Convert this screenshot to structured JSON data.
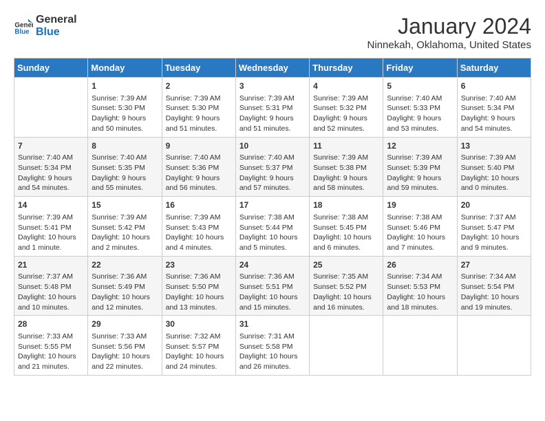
{
  "header": {
    "logo_line1": "General",
    "logo_line2": "Blue",
    "title": "January 2024",
    "subtitle": "Ninnekah, Oklahoma, United States"
  },
  "columns": [
    "Sunday",
    "Monday",
    "Tuesday",
    "Wednesday",
    "Thursday",
    "Friday",
    "Saturday"
  ],
  "weeks": [
    [
      {
        "day": "",
        "info": ""
      },
      {
        "day": "1",
        "info": "Sunrise: 7:39 AM\nSunset: 5:30 PM\nDaylight: 9 hours\nand 50 minutes."
      },
      {
        "day": "2",
        "info": "Sunrise: 7:39 AM\nSunset: 5:30 PM\nDaylight: 9 hours\nand 51 minutes."
      },
      {
        "day": "3",
        "info": "Sunrise: 7:39 AM\nSunset: 5:31 PM\nDaylight: 9 hours\nand 51 minutes."
      },
      {
        "day": "4",
        "info": "Sunrise: 7:39 AM\nSunset: 5:32 PM\nDaylight: 9 hours\nand 52 minutes."
      },
      {
        "day": "5",
        "info": "Sunrise: 7:40 AM\nSunset: 5:33 PM\nDaylight: 9 hours\nand 53 minutes."
      },
      {
        "day": "6",
        "info": "Sunrise: 7:40 AM\nSunset: 5:34 PM\nDaylight: 9 hours\nand 54 minutes."
      }
    ],
    [
      {
        "day": "7",
        "info": "Sunrise: 7:40 AM\nSunset: 5:34 PM\nDaylight: 9 hours\nand 54 minutes."
      },
      {
        "day": "8",
        "info": "Sunrise: 7:40 AM\nSunset: 5:35 PM\nDaylight: 9 hours\nand 55 minutes."
      },
      {
        "day": "9",
        "info": "Sunrise: 7:40 AM\nSunset: 5:36 PM\nDaylight: 9 hours\nand 56 minutes."
      },
      {
        "day": "10",
        "info": "Sunrise: 7:40 AM\nSunset: 5:37 PM\nDaylight: 9 hours\nand 57 minutes."
      },
      {
        "day": "11",
        "info": "Sunrise: 7:39 AM\nSunset: 5:38 PM\nDaylight: 9 hours\nand 58 minutes."
      },
      {
        "day": "12",
        "info": "Sunrise: 7:39 AM\nSunset: 5:39 PM\nDaylight: 9 hours\nand 59 minutes."
      },
      {
        "day": "13",
        "info": "Sunrise: 7:39 AM\nSunset: 5:40 PM\nDaylight: 10 hours\nand 0 minutes."
      }
    ],
    [
      {
        "day": "14",
        "info": "Sunrise: 7:39 AM\nSunset: 5:41 PM\nDaylight: 10 hours\nand 1 minute."
      },
      {
        "day": "15",
        "info": "Sunrise: 7:39 AM\nSunset: 5:42 PM\nDaylight: 10 hours\nand 2 minutes."
      },
      {
        "day": "16",
        "info": "Sunrise: 7:39 AM\nSunset: 5:43 PM\nDaylight: 10 hours\nand 4 minutes."
      },
      {
        "day": "17",
        "info": "Sunrise: 7:38 AM\nSunset: 5:44 PM\nDaylight: 10 hours\nand 5 minutes."
      },
      {
        "day": "18",
        "info": "Sunrise: 7:38 AM\nSunset: 5:45 PM\nDaylight: 10 hours\nand 6 minutes."
      },
      {
        "day": "19",
        "info": "Sunrise: 7:38 AM\nSunset: 5:46 PM\nDaylight: 10 hours\nand 7 minutes."
      },
      {
        "day": "20",
        "info": "Sunrise: 7:37 AM\nSunset: 5:47 PM\nDaylight: 10 hours\nand 9 minutes."
      }
    ],
    [
      {
        "day": "21",
        "info": "Sunrise: 7:37 AM\nSunset: 5:48 PM\nDaylight: 10 hours\nand 10 minutes."
      },
      {
        "day": "22",
        "info": "Sunrise: 7:36 AM\nSunset: 5:49 PM\nDaylight: 10 hours\nand 12 minutes."
      },
      {
        "day": "23",
        "info": "Sunrise: 7:36 AM\nSunset: 5:50 PM\nDaylight: 10 hours\nand 13 minutes."
      },
      {
        "day": "24",
        "info": "Sunrise: 7:36 AM\nSunset: 5:51 PM\nDaylight: 10 hours\nand 15 minutes."
      },
      {
        "day": "25",
        "info": "Sunrise: 7:35 AM\nSunset: 5:52 PM\nDaylight: 10 hours\nand 16 minutes."
      },
      {
        "day": "26",
        "info": "Sunrise: 7:34 AM\nSunset: 5:53 PM\nDaylight: 10 hours\nand 18 minutes."
      },
      {
        "day": "27",
        "info": "Sunrise: 7:34 AM\nSunset: 5:54 PM\nDaylight: 10 hours\nand 19 minutes."
      }
    ],
    [
      {
        "day": "28",
        "info": "Sunrise: 7:33 AM\nSunset: 5:55 PM\nDaylight: 10 hours\nand 21 minutes."
      },
      {
        "day": "29",
        "info": "Sunrise: 7:33 AM\nSunset: 5:56 PM\nDaylight: 10 hours\nand 22 minutes."
      },
      {
        "day": "30",
        "info": "Sunrise: 7:32 AM\nSunset: 5:57 PM\nDaylight: 10 hours\nand 24 minutes."
      },
      {
        "day": "31",
        "info": "Sunrise: 7:31 AM\nSunset: 5:58 PM\nDaylight: 10 hours\nand 26 minutes."
      },
      {
        "day": "",
        "info": ""
      },
      {
        "day": "",
        "info": ""
      },
      {
        "day": "",
        "info": ""
      }
    ]
  ]
}
